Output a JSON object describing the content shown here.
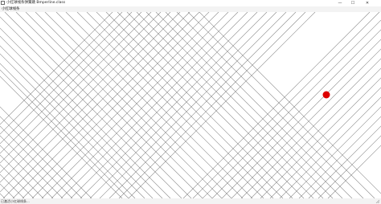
{
  "window": {
    "title": "小红球线条弹簧跳 Bmperline.class",
    "menu_label": "小红球线条",
    "minimize_glyph": "—",
    "maximize_glyph": "☐",
    "close_glyph": "✕"
  },
  "status": {
    "text": "已激活小红球线条..."
  },
  "colors": {
    "ball": "#dd0000",
    "line": "#8a8a8a",
    "menubar": "#f3f3f3"
  }
}
